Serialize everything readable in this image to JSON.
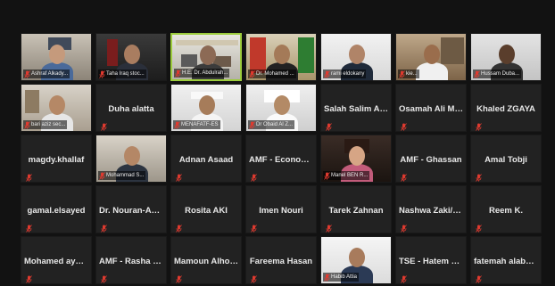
{
  "colors": {
    "background": "#121212",
    "tile": "#222222",
    "active_speaker_border": "#9ccc3c",
    "muted_mic": "#e03a2f"
  },
  "participants": [
    {
      "name": "Ashraf Alkady...",
      "video": true
    },
    {
      "name": "Taha Iraq stoc...",
      "video": true
    },
    {
      "name": "H.E. Dr. Abdulrah...",
      "video": true,
      "speaking": true
    },
    {
      "name": "Dr. Mohamed ...",
      "video": true
    },
    {
      "name": "rami eldokany",
      "video": true
    },
    {
      "name": "kie...",
      "video": true
    },
    {
      "name": "Hussam Duba...",
      "video": true
    },
    {
      "name": "bari aziz sec...",
      "video": true
    },
    {
      "name": "Duha alatta",
      "video": false
    },
    {
      "name": "MENAFATF-ES",
      "video": true
    },
    {
      "name": "Dr Obaid Al Z...",
      "video": true
    },
    {
      "name": "Salah Salim Al-T...",
      "video": false
    },
    {
      "name": "Osamah Ali Mo...",
      "video": false
    },
    {
      "name": "Khaled ZGAYA",
      "video": false
    },
    {
      "name": "magdy.khallaf",
      "video": false
    },
    {
      "name": "Mohammad S...",
      "video": true
    },
    {
      "name": "Adnan Asaad",
      "video": false
    },
    {
      "name": "AMF - Economic",
      "video": false
    },
    {
      "name": "Manel BEN R...",
      "video": true
    },
    {
      "name": "AMF - Ghassan",
      "video": false
    },
    {
      "name": "Amal Tobji",
      "video": false
    },
    {
      "name": "gamal.elsayed",
      "video": false
    },
    {
      "name": "Dr. Nouran-AMF",
      "video": false
    },
    {
      "name": "Rosita AKI",
      "video": false
    },
    {
      "name": "Imen Nouri",
      "video": false
    },
    {
      "name": "Tarek Zahnan",
      "video": false
    },
    {
      "name": "Nashwa Zaki/ In...",
      "video": false
    },
    {
      "name": "Reem K.",
      "video": false
    },
    {
      "name": "Mohamed ayyad",
      "video": false
    },
    {
      "name": "AMF - Rasha El...",
      "video": false
    },
    {
      "name": "Mamoun Alhom...",
      "video": false
    },
    {
      "name": "Fareema Hasan",
      "video": false
    },
    {
      "name": "Habib Attia",
      "video": true
    },
    {
      "name": "TSE - Hatem Be...",
      "video": false
    },
    {
      "name": "fatemah alabdu...",
      "video": false
    }
  ]
}
